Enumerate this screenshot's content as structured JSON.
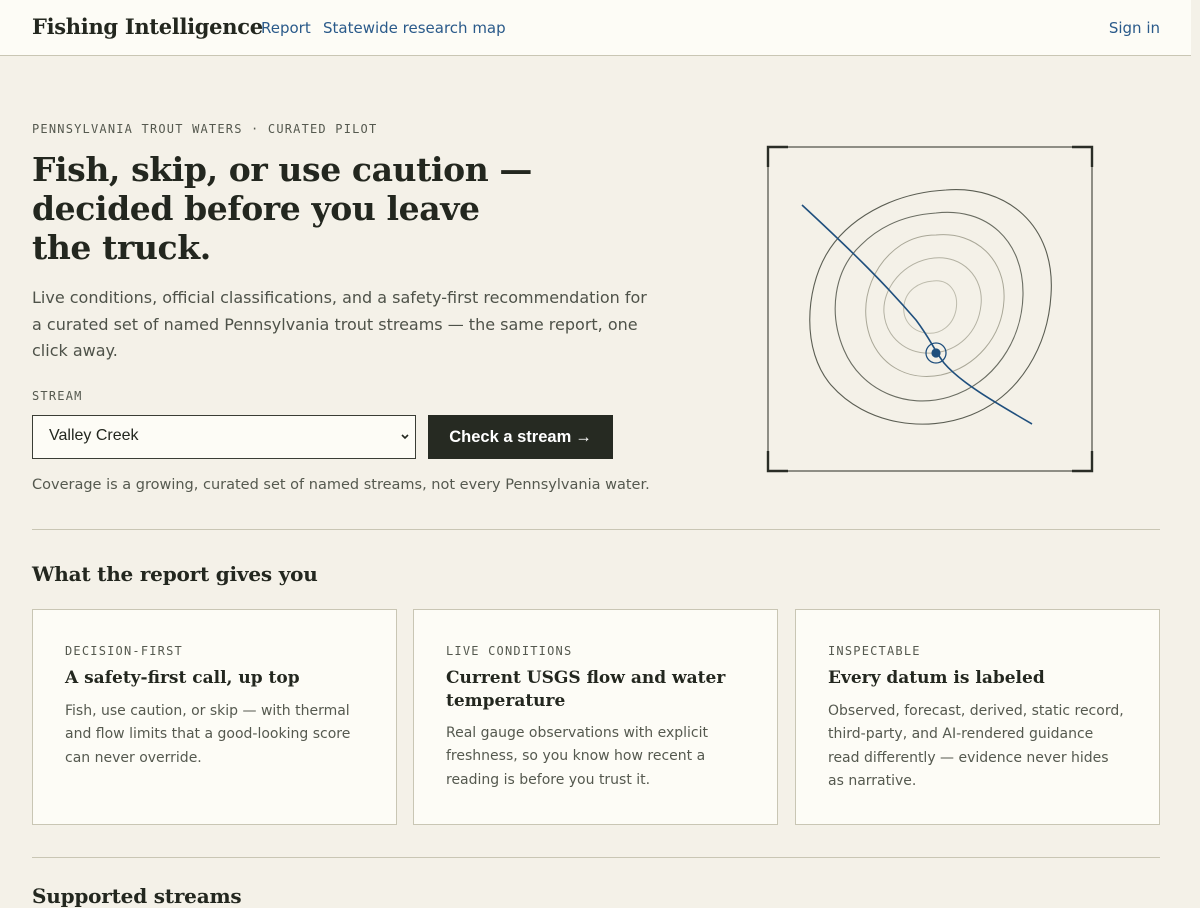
{
  "header": {
    "brand": "Fishing Intelligence",
    "nav": {
      "report": "Report",
      "map": "Statewide research map"
    },
    "sign_in": "Sign in"
  },
  "hero": {
    "eyebrow": "PENNSYLVANIA TROUT WATERS · CURATED PILOT",
    "title": "Fish, skip, or use caution — decided before you leave the truck.",
    "lead": "Live conditions, official classifications, and a safety-first recommendation for a curated set of named Pennsylvania trout streams — the same report, one click away.",
    "stream_label": "STREAM",
    "stream_value": "Valley Creek",
    "button_label": "Check a stream",
    "button_arrow": "→",
    "coverage_note": "Coverage is a growing, curated set of named streams, not every Pennsylvania water."
  },
  "features": {
    "title": "What the report gives you",
    "cards": [
      {
        "eyebrow": "DECISION-FIRST",
        "title": "A safety-first call, up top",
        "body": "Fish, use caution, or skip — with thermal and flow limits that a good-looking score can never override."
      },
      {
        "eyebrow": "LIVE CONDITIONS",
        "title": "Current USGS flow and water temperature",
        "body": "Real gauge observations with explicit freshness, so you know how recent a reading is before you trust it."
      },
      {
        "eyebrow": "INSPECTABLE",
        "title": "Every datum is labeled",
        "body": "Observed, forecast, derived, static record, third-party, and AI-rendered guidance read differently — evidence never hides as narrative."
      }
    ]
  },
  "next_section": {
    "title": "Supported streams"
  },
  "colors": {
    "background": "#f4f1e8",
    "surface": "#fdfcf6",
    "ink": "#23271f",
    "link": "#2a5a8a",
    "river": "#1f4f7d",
    "button": "#262a22"
  }
}
